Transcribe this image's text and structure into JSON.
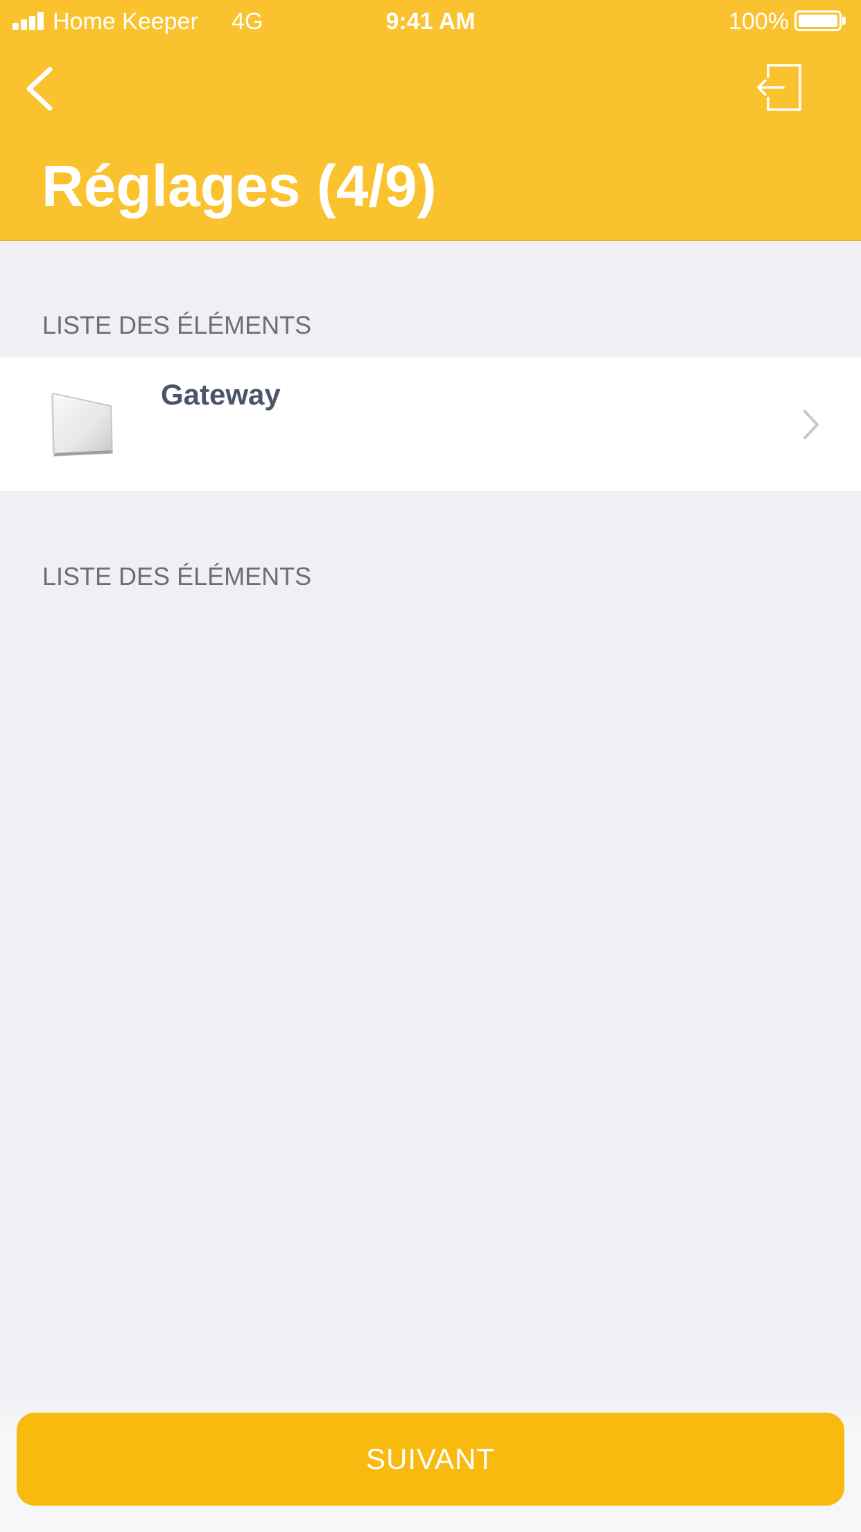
{
  "status_bar": {
    "carrier": "Home Keeper",
    "network": "4G",
    "time": "9:41 AM",
    "battery": "100%",
    "battery_level": 1.0
  },
  "nav": {
    "title": "Réglages (4/9)",
    "back_icon": "chevron-left-icon",
    "exit_icon": "exit-door-icon"
  },
  "sections": [
    {
      "header": "LISTE DES ÉLÉMENTS",
      "items": [
        {
          "title": "Gateway",
          "icon": "gateway-device-icon"
        }
      ]
    },
    {
      "header": "LISTE DES ÉLÉMENTS",
      "items": []
    }
  ],
  "footer": {
    "next_label": "SUIVANT"
  },
  "colors": {
    "header_bg": "#F9C22E",
    "button_bg": "#F9BA10",
    "page_bg": "#EFEFF4",
    "section_text": "#6D6D72",
    "item_text": "#4A5568"
  }
}
